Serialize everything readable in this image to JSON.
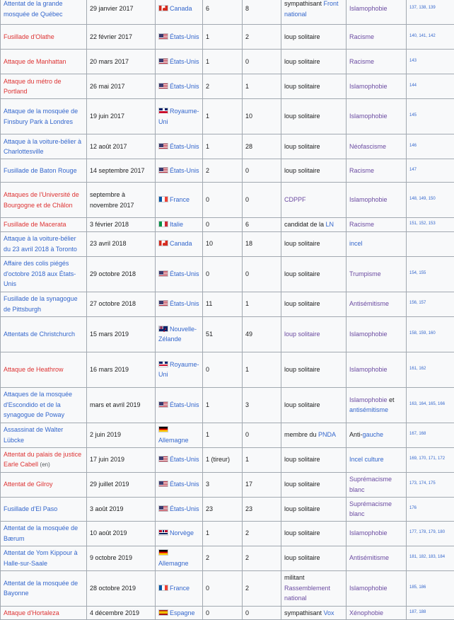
{
  "rows": [
    {
      "attack": "Attentat de la grande mosquée de Québec",
      "attack_color": "blue",
      "date": "29 janvier 2017",
      "flag": "canada",
      "country": "Canada",
      "killed": "6",
      "injured": "8",
      "perp_prefix": "sympathisant ",
      "perp_link": "Front national",
      "perp_link_color": "blue",
      "motive": "Islamophobie",
      "motive_color": "purple",
      "refs": "137, 138, 139"
    },
    {
      "attack": "Fusillade d'Olathe",
      "attack_color": "red",
      "date": "22 février 2017",
      "flag": "usa",
      "country": "États-Unis",
      "killed": "1",
      "injured": "2",
      "perp_prefix": "loup solitaire",
      "perp_link": "",
      "perp_link_color": "blue",
      "motive": "Racisme",
      "motive_color": "purple",
      "refs": "140, 141, 142"
    },
    {
      "attack": "Attaque de Manhattan",
      "attack_color": "red",
      "date": "20 mars 2017",
      "flag": "usa",
      "country": "États-Unis",
      "killed": "1",
      "injured": "0",
      "perp_prefix": "loup solitaire",
      "perp_link": "",
      "perp_link_color": "blue",
      "motive": "Racisme",
      "motive_color": "purple",
      "refs": "143"
    },
    {
      "attack": "Attaque du métro de Portland",
      "attack_color": "red",
      "date": "26 mai 2017",
      "flag": "usa",
      "country": "États-Unis",
      "killed": "2",
      "injured": "1",
      "perp_prefix": "loup solitaire",
      "perp_link": "",
      "perp_link_color": "blue",
      "motive": "Islamophobie",
      "motive_color": "purple",
      "refs": "144"
    },
    {
      "attack": "Attaque de la mosquée de Finsbury Park à Londres",
      "attack_color": "blue",
      "date": "19 juin 2017",
      "flag": "uk",
      "country": "Royaume-Uni",
      "killed": "1",
      "injured": "10",
      "perp_prefix": "loup solitaire",
      "perp_link": "",
      "perp_link_color": "blue",
      "motive": "Islamophobie",
      "motive_color": "purple",
      "refs": "145"
    },
    {
      "attack": "Attaque à la voiture-bélier à Charlottesville",
      "attack_color": "blue",
      "date": "12 août 2017",
      "flag": "usa",
      "country": "États-Unis",
      "killed": "1",
      "injured": "28",
      "perp_prefix": "loup solitaire",
      "perp_link": "",
      "perp_link_color": "blue",
      "motive": "Néofascisme",
      "motive_color": "purple",
      "refs": "146"
    },
    {
      "attack": "Fusillade de Baton Rouge",
      "attack_color": "blue",
      "date": "14 septembre 2017",
      "flag": "usa",
      "country": "États-Unis",
      "killed": "2",
      "injured": "0",
      "perp_prefix": "loup solitaire",
      "perp_link": "",
      "perp_link_color": "blue",
      "motive": "Racisme",
      "motive_color": "purple",
      "refs": "147"
    },
    {
      "attack": "Attaques de l'Université de Bourgogne et de Châlon",
      "attack_color": "red",
      "date": "septembre à novembre 2017",
      "flag": "france",
      "country": "France",
      "killed": "0",
      "injured": "0",
      "perp_prefix": "",
      "perp_link": "CDPPF",
      "perp_link_color": "purple",
      "motive": "Islamophobie",
      "motive_color": "purple",
      "refs": "148, 149, 150"
    },
    {
      "attack": "Fusillade de Macerata",
      "attack_color": "red",
      "date": "3 février 2018",
      "flag": "italy",
      "country": "Italie",
      "killed": "0",
      "injured": "6",
      "perp_prefix": "candidat de la ",
      "perp_link": "LN",
      "perp_link_color": "blue",
      "motive": "Racisme",
      "motive_color": "purple",
      "refs": "151, 152, 153"
    },
    {
      "attack": "Attaque à la voiture-bélier du 23 avril 2018 à Toronto",
      "attack_color": "blue",
      "date": "23 avril 2018",
      "flag": "canada",
      "country": "Canada",
      "killed": "10",
      "injured": "18",
      "perp_prefix": "loup solitaire",
      "perp_link": "",
      "perp_link_color": "blue",
      "motive": "incel",
      "motive_color": "blue",
      "refs": ""
    },
    {
      "attack": "Affaire des colis piégés d'octobre 2018 aux États-Unis",
      "attack_color": "blue",
      "date": "29 octobre 2018",
      "flag": "usa",
      "country": "États-Unis",
      "killed": "0",
      "injured": "0",
      "perp_prefix": "loup solitaire",
      "perp_link": "",
      "perp_link_color": "blue",
      "motive": "Trumpisme",
      "motive_color": "purple",
      "refs": "154, 155"
    },
    {
      "attack": "Fusillade de la synagogue de Pittsburgh",
      "attack_color": "blue",
      "date": "27 octobre 2018",
      "flag": "usa",
      "country": "États-Unis",
      "killed": "11",
      "injured": "1",
      "perp_prefix": "loup solitaire",
      "perp_link": "",
      "perp_link_color": "blue",
      "motive": "Antisémitisme",
      "motive_color": "purple",
      "refs": "156, 157"
    },
    {
      "attack": "Attentats de Christchurch",
      "attack_color": "blue",
      "date": "15 mars 2019",
      "flag": "nz",
      "country": "Nouvelle-Zélande",
      "killed": "51",
      "injured": "49",
      "perp_prefix": "",
      "perp_link": "loup solitaire",
      "perp_link_color": "purple",
      "motive": "Islamophobie",
      "motive_color": "purple",
      "refs": "158, 159, 160"
    },
    {
      "attack": "Attaque de Heathrow",
      "attack_color": "red",
      "date": "16 mars 2019",
      "flag": "uk",
      "country": "Royaume-Uni",
      "killed": "0",
      "injured": "1",
      "perp_prefix": "loup solitaire",
      "perp_link": "",
      "perp_link_color": "blue",
      "motive": "Islamophobie",
      "motive_color": "purple",
      "refs": "161, 162"
    },
    {
      "attack": "Attaques de la mosquée d'Escondido et de la synagogue de Poway",
      "attack_color": "blue",
      "date": "mars et avril 2019",
      "flag": "usa",
      "country": "États-Unis",
      "killed": "1",
      "injured": "3",
      "perp_prefix": "loup solitaire",
      "perp_link": "",
      "perp_link_color": "blue",
      "motive": "Islamophobie",
      "motive_color": "purple",
      "motive_mid": " et ",
      "motive2": "antisémitisme",
      "refs": "163, 164, 165, 166"
    },
    {
      "attack": "Assassinat de Walter Lübcke",
      "attack_color": "blue",
      "date": "2 juin 2019",
      "flag": "germany",
      "country": "Allemagne",
      "killed": "1",
      "injured": "0",
      "perp_prefix": "membre du ",
      "perp_link": "PNDA",
      "perp_link_color": "blue",
      "motive": "Anti-",
      "motive_color": "black",
      "motive2": "gauche",
      "refs": "167, 168"
    },
    {
      "attack": "Attentat du palais de justice Earle Cabell",
      "attack_color": "red",
      "attack_suffix": "(en)",
      "date": "17 juin 2019",
      "flag": "usa",
      "country": "États-Unis",
      "killed": "1 (tireur)",
      "injured": "1",
      "perp_prefix": "loup solitaire",
      "perp_link": "",
      "perp_link_color": "blue",
      "motive": "Incel culture",
      "motive_color": "blue",
      "refs": "169, 170, 171, 172"
    },
    {
      "attack": "Attentat de Gilroy",
      "attack_color": "red",
      "date": "29 juillet 2019",
      "flag": "usa",
      "country": "États-Unis",
      "killed": "3",
      "injured": "17",
      "perp_prefix": "loup solitaire",
      "perp_link": "",
      "perp_link_color": "blue",
      "motive": "Suprémacisme blanc",
      "motive_color": "purple",
      "refs": "173, 174, 175"
    },
    {
      "attack": "Fusillade d'El Paso",
      "attack_color": "blue",
      "date": "3 août 2019",
      "flag": "usa",
      "country": "États-Unis",
      "killed": "23",
      "injured": "23",
      "perp_prefix": "loup solitaire",
      "perp_link": "",
      "perp_link_color": "blue",
      "motive": "Suprémacisme blanc",
      "motive_color": "purple",
      "refs": "176"
    },
    {
      "attack": "Attentat de la mosquée de Bærum",
      "attack_color": "blue",
      "date": "10 août 2019",
      "flag": "norway",
      "country": "Norvège",
      "killed": "1",
      "injured": "2",
      "perp_prefix": "loup solitaire",
      "perp_link": "",
      "perp_link_color": "blue",
      "motive": "Islamophobie",
      "motive_color": "purple",
      "refs": "177, 178, 179, 180"
    },
    {
      "attack": "Attentat de Yom Kippour à Halle-sur-Saale",
      "attack_color": "blue",
      "date": "9 octobre 2019",
      "flag": "germany",
      "country": "Allemagne",
      "killed": "2",
      "injured": "2",
      "perp_prefix": "loup solitaire",
      "perp_link": "",
      "perp_link_color": "blue",
      "motive": "Antisémitisme",
      "motive_color": "purple",
      "refs": "181, 182, 183, 184"
    },
    {
      "attack": "Attentat de la mosquée de Bayonne",
      "attack_color": "blue",
      "date": "28 octobre 2019",
      "flag": "france",
      "country": "France",
      "killed": "0",
      "injured": "2",
      "perp_prefix": "militant ",
      "perp_link": "Rassemblement national",
      "perp_link_color": "purple",
      "motive": "Islamophobie",
      "motive_color": "purple",
      "refs": "185, 186"
    },
    {
      "attack": "Attaque d'Hortaleza",
      "attack_color": "red",
      "date": "4 décembre 2019",
      "flag": "spain",
      "country": "Espagne",
      "killed": "0",
      "injured": "0",
      "perp_prefix": "sympathisant ",
      "perp_link": "Vox",
      "perp_link_color": "blue",
      "motive": "Xénophobie",
      "motive_color": "purple",
      "refs": "187, 188"
    }
  ]
}
